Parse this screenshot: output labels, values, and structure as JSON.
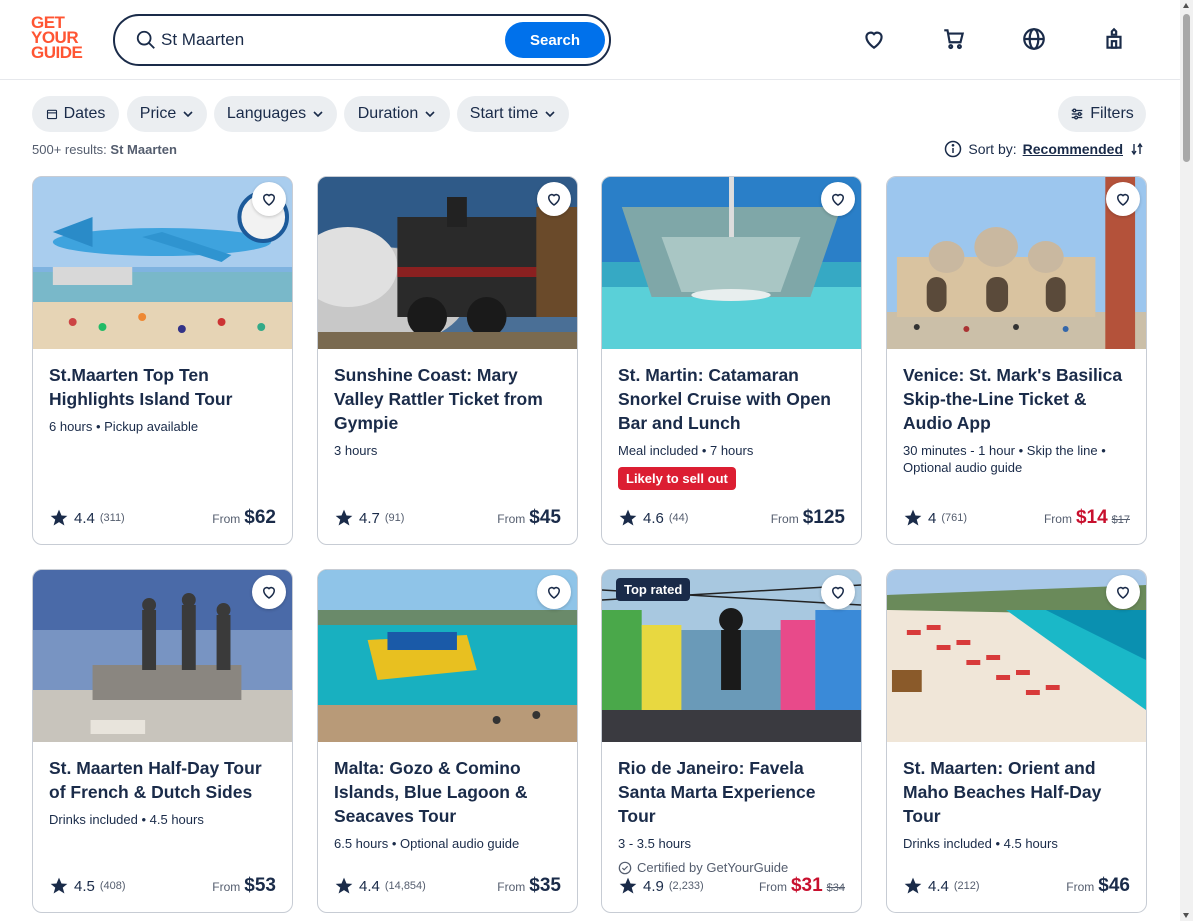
{
  "brand": {
    "logo_line1": "GET",
    "logo_line2": "YOUR",
    "logo_line3": "GUIDE",
    "color": "#ff5533"
  },
  "search": {
    "value": "St Maarten",
    "button_label": "Search"
  },
  "header_icons": [
    "heart-icon",
    "cart-icon",
    "globe-icon",
    "account-icon"
  ],
  "filters": {
    "dates": "Dates",
    "price": "Price",
    "languages": "Languages",
    "duration": "Duration",
    "start_time": "Start time",
    "filters": "Filters"
  },
  "results": {
    "count": "500+ results:",
    "query": "St Maarten"
  },
  "sort": {
    "label": "Sort by:",
    "value": "Recommended"
  },
  "cards": [
    {
      "title": "St.Maarten Top Ten Highlights Island Tour",
      "meta": "6 hours • Pickup available",
      "rating": "4.4",
      "reviews": "(311)",
      "from": "From",
      "price": "$62"
    },
    {
      "title": "Sunshine Coast: Mary Valley Rattler Ticket from Gympie",
      "meta": "3 hours",
      "rating": "4.7",
      "reviews": "(91)",
      "from": "From",
      "price": "$45"
    },
    {
      "title": "St. Martin: Catamaran Snorkel Cruise with Open Bar and Lunch",
      "meta": "Meal included • 7 hours",
      "badge": "Likely to sell out",
      "rating": "4.6",
      "reviews": "(44)",
      "from": "From",
      "price": "$125"
    },
    {
      "title": "Venice: St. Mark's Basilica Skip-the-Line Ticket & Audio App",
      "meta": "30 minutes - 1 hour • Skip the line • Optional audio guide",
      "rating": "4",
      "reviews": "(761)",
      "from": "From",
      "price": "$14",
      "old_price": "$17"
    },
    {
      "title": "St. Maarten Half-Day Tour of French & Dutch Sides",
      "meta": "Drinks included • 4.5 hours",
      "rating": "4.5",
      "reviews": "(408)",
      "from": "From",
      "price": "$53"
    },
    {
      "title": "Malta: Gozo & Comino Islands, Blue Lagoon & Seacaves Tour",
      "meta": "6.5 hours • Optional audio guide",
      "rating": "4.4",
      "reviews": "(14,854)",
      "from": "From",
      "price": "$35"
    },
    {
      "title": "Rio de Janeiro: Favela Santa Marta Experience Tour",
      "meta": "3 - 3.5 hours",
      "top_badge": "Top rated",
      "cert": "Certified by GetYourGuide",
      "rating": "4.9",
      "reviews": "(2,233)",
      "from": "From",
      "price": "$31",
      "old_price": "$34"
    },
    {
      "title": "St. Maarten: Orient and Maho Beaches Half-Day Tour",
      "meta": "Drinks included • 4.5 hours",
      "rating": "4.4",
      "reviews": "(212)",
      "from": "From",
      "price": "$46"
    }
  ],
  "colors": {
    "accent": "#0071eb",
    "text": "#1a2b49",
    "sale": "#c8102e",
    "sellout": "#dc1e32",
    "chip_bg": "#ebeef1"
  }
}
